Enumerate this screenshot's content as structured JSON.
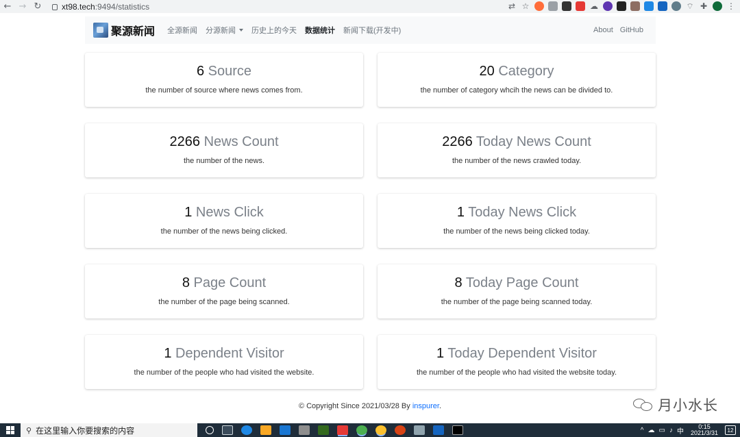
{
  "browser": {
    "url_host": "xt98.tech",
    "url_path": ":9494/statistics"
  },
  "navbar": {
    "brand": "聚源新闻",
    "links": [
      {
        "label": "全源新闻"
      },
      {
        "label": "分源新闻"
      },
      {
        "label": "历史上的今天"
      },
      {
        "label": "数据统计"
      },
      {
        "label": "新闻下载(开发中)"
      }
    ],
    "right_links": [
      {
        "label": "About"
      },
      {
        "label": "GitHub"
      }
    ]
  },
  "stats": [
    {
      "value": "6",
      "label": "Source",
      "desc": "the number of source where news comes from."
    },
    {
      "value": "20",
      "label": "Category",
      "desc": "the number of category whcih the news can be divided to."
    },
    {
      "value": "2266",
      "label": "News Count",
      "desc": "the number of the news."
    },
    {
      "value": "2266",
      "label": "Today News Count",
      "desc": "the number of the news crawled today."
    },
    {
      "value": "1",
      "label": "News Click",
      "desc": "the number of the news being clicked."
    },
    {
      "value": "1",
      "label": "Today News Click",
      "desc": "the number of the news being clicked today."
    },
    {
      "value": "8",
      "label": "Page Count",
      "desc": "the number of the page being scanned."
    },
    {
      "value": "8",
      "label": "Today Page Count",
      "desc": "the number of the page being scanned today."
    },
    {
      "value": "1",
      "label": "Dependent Visitor",
      "desc": "the number of the people who had visited the website."
    },
    {
      "value": "1",
      "label": "Today Dependent Visitor",
      "desc": "the number of the people who had visited the website today."
    }
  ],
  "footer": {
    "prefix": "© Copyright Since 2021/03/28 By ",
    "author": "inspurer",
    "suffix": "."
  },
  "watermark": {
    "text": "月小水长"
  },
  "taskbar": {
    "search_placeholder": "在这里输入你要搜索的内容",
    "ime": "中",
    "time": "0:15",
    "date": "2021/3/31",
    "notification_count": "12"
  },
  "colors": {
    "navbar_bg": "#f8f9fa",
    "label_gray": "#7b8189",
    "link_blue": "#0d6efd",
    "taskbar_bg": "#1f2d3a"
  }
}
